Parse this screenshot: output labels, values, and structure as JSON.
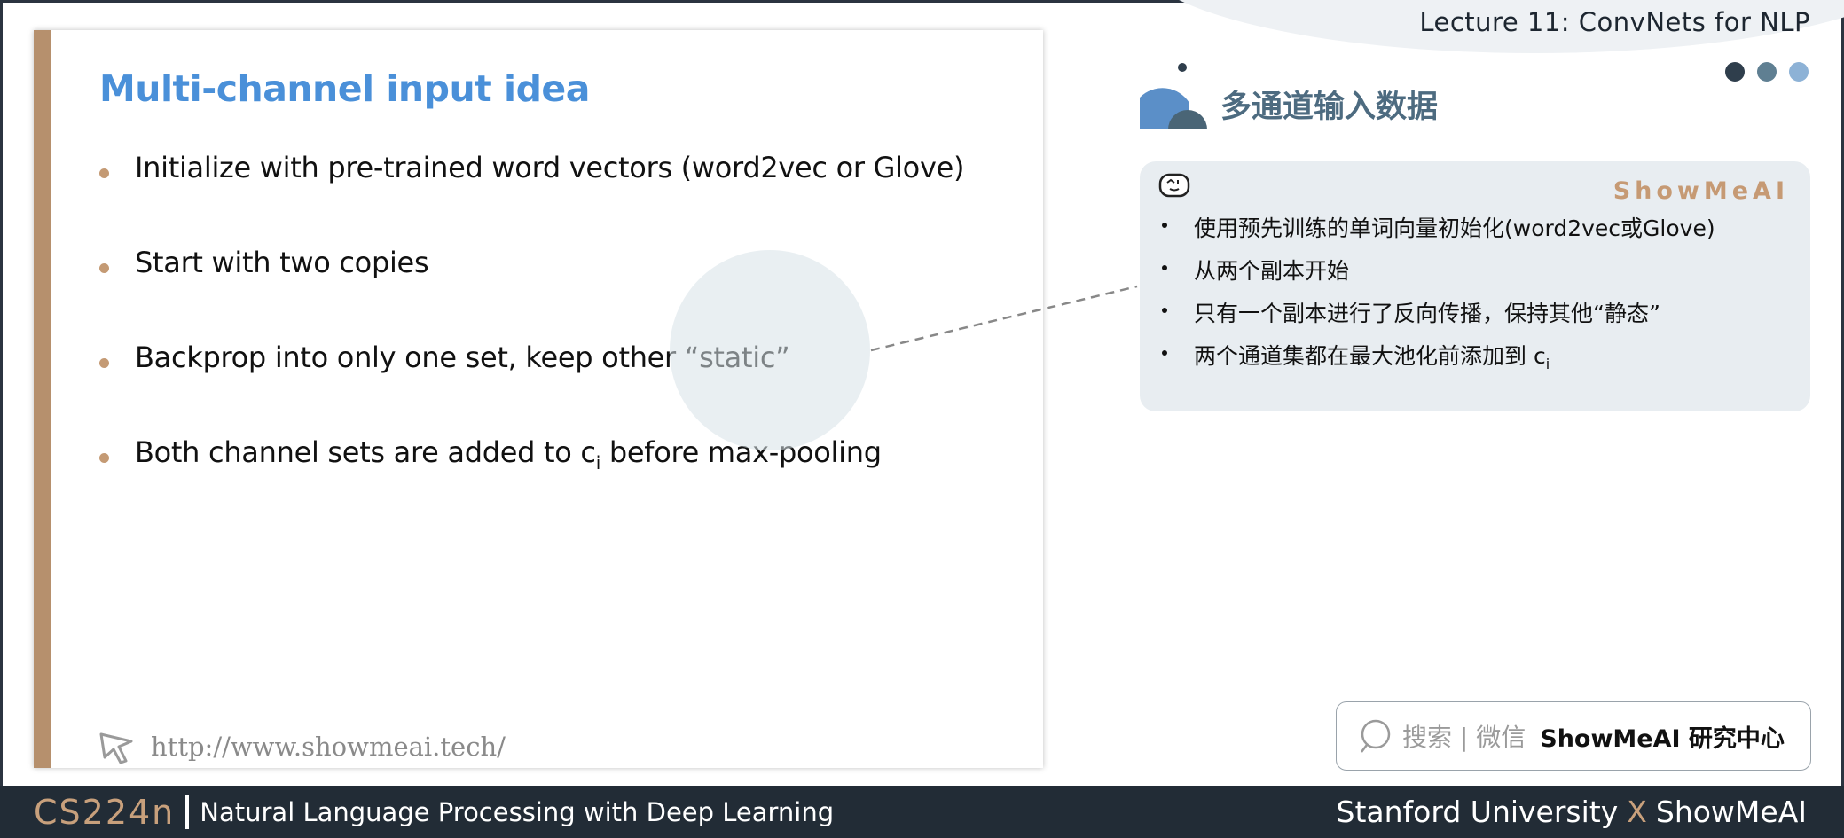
{
  "header": {
    "lecture_title": "Lecture 11: ConvNets for NLP",
    "dot_colors": [
      "#2f3e4c",
      "#5f7f92",
      "#8db2d6"
    ]
  },
  "slide": {
    "title": "Multi-channel input idea",
    "bullets": [
      {
        "text": "Initialize with pre-trained word vectors (word2vec or Glove)"
      },
      {
        "text": "Start with two copies"
      },
      {
        "text": "Backprop into only one set, keep other “static”"
      },
      {
        "text_before": "Both channel sets are added to c",
        "sub": "i",
        "text_after": " before max-pooling"
      }
    ],
    "link": "http://www.showmeai.tech/",
    "accent_color": "#b6906d",
    "title_color": "#4a90d9"
  },
  "panel": {
    "section_title": "多通道输入数据",
    "brand": "ShowMeAI",
    "items": [
      {
        "text": "使用预先训练的单词向量初始化(word2vec或Glove)"
      },
      {
        "text": "从两个副本开始"
      },
      {
        "text": "只有一个副本进行了反向传播，保持其他“静态”"
      },
      {
        "text_before": "两个通道集都在最大池化前添加到 c",
        "sub": "i"
      }
    ]
  },
  "search": {
    "label": "搜索 | 微信",
    "brand": "ShowMeAI 研究中心"
  },
  "footer": {
    "course_code": "CS224n",
    "course_name": "Natural Language Processing with Deep Learning",
    "university": "Stanford University",
    "x": "X",
    "partner": "ShowMeAI"
  }
}
